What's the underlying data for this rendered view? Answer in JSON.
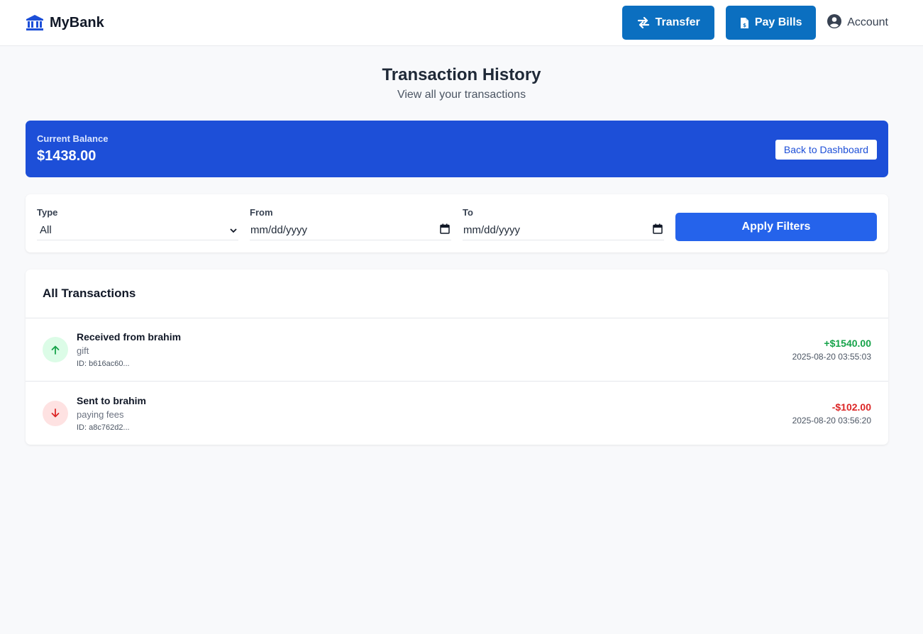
{
  "brand": {
    "name": "MyBank",
    "icon": "bank-icon",
    "icon_color": "#1d4fd8"
  },
  "nav": {
    "transfer_label": "Transfer",
    "bills_label": "Pay Bills",
    "account_label": "Account"
  },
  "page": {
    "title": "Transaction History",
    "subtitle": "View all your transactions"
  },
  "balance": {
    "label": "Current Balance",
    "value": "$1438.00",
    "back_label": "Back to Dashboard"
  },
  "filters": {
    "type_label": "Type",
    "type_value": "All",
    "from_label": "From",
    "from_placeholder": "mm/dd/yyyy",
    "to_label": "To",
    "to_placeholder": "mm/dd/yyyy",
    "apply_label": "Apply Filters"
  },
  "transactions": {
    "heading": "All Transactions",
    "items": [
      {
        "title": "Received from brahim",
        "description": "gift",
        "id": "ID: b616ac60...",
        "amount": "+$1540.00",
        "date": "2025-08-20 03:55:03",
        "direction": "in"
      },
      {
        "title": "Sent to brahim",
        "description": "paying fees",
        "id": "ID: a8c762d2...",
        "amount": "-$102.00",
        "date": "2025-08-20 03:56:20",
        "direction": "out"
      }
    ]
  },
  "colors": {
    "primary": "#0b6fc0",
    "balance_bg": "#1d4fd8",
    "apply_bg": "#2563eb",
    "positive": "#16a34a",
    "negative": "#dc2626"
  }
}
